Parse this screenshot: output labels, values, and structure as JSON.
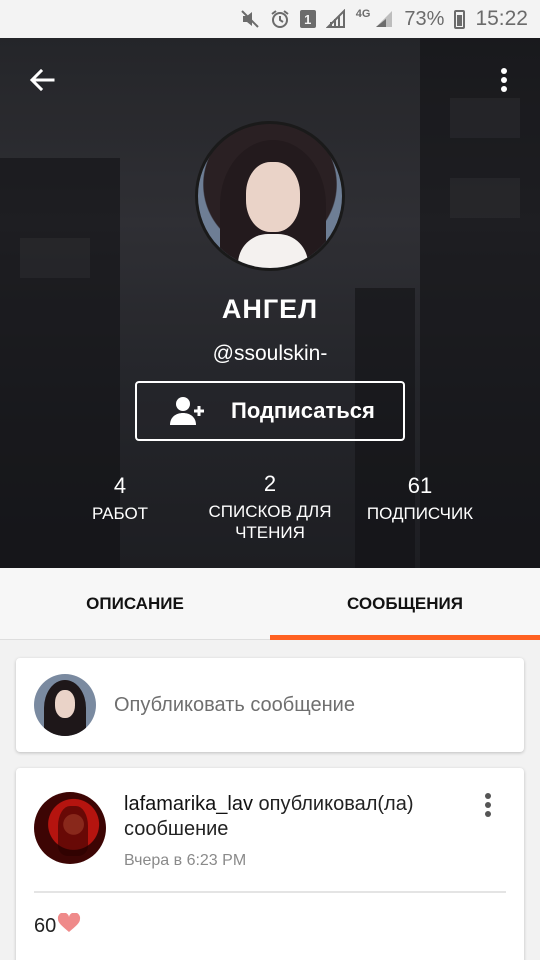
{
  "status_bar": {
    "battery_text": "73%",
    "time": "15:22",
    "sim_badge": "1",
    "network": "4G",
    "icons": [
      "mute-icon",
      "alarm-icon",
      "sim-icon",
      "signal-icon",
      "signal-icon",
      "battery-icon"
    ]
  },
  "header": {
    "back_icon": "arrow-back-icon",
    "menu_icon": "more-vertical-icon"
  },
  "profile": {
    "name": "АНГЕЛ",
    "handle": "@ssoulskin-",
    "follow_label": "Подписаться",
    "follow_icon": "add-user-icon"
  },
  "stats": [
    {
      "value": "4",
      "label": "РАБОТ"
    },
    {
      "value": "2",
      "label": "СПИСКОВ ДЛЯ ЧТЕНИЯ"
    },
    {
      "value": "61",
      "label": "ПОДПИСЧИК"
    }
  ],
  "tabs": [
    {
      "label": "ОПИСАНИЕ",
      "active": false
    },
    {
      "label": "СООБЩЕНИЯ",
      "active": true
    }
  ],
  "compose": {
    "placeholder": "Опубликовать сообщение"
  },
  "messages": [
    {
      "author": "lafamarika_lav",
      "action": "опубликовал(ла) сообшение",
      "time": "Вчера в 6:23 PM",
      "body": "60"
    }
  ],
  "colors": {
    "accent": "#ff6122",
    "heart": "#ef8a8a"
  }
}
